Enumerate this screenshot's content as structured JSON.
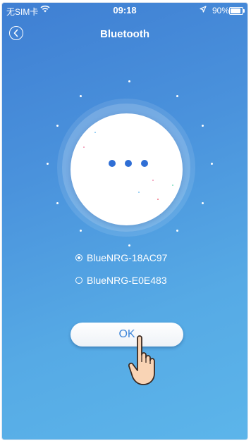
{
  "status_bar": {
    "carrier": "无SIM卡",
    "time": "09:18",
    "battery": "90%",
    "battery_level": 0.9
  },
  "header": {
    "title": "Bluetooth",
    "back_icon": "chevron-left-icon"
  },
  "devices": [
    {
      "name": "BlueNRG-18AC97",
      "selected": true
    },
    {
      "name": "BlueNRG-E0E483",
      "selected": false
    }
  ],
  "ok_button": {
    "label": "OK"
  },
  "icons": {
    "status": [
      "wifi-icon",
      "location-arrow-icon",
      "battery-icon"
    ],
    "scanning": "ellipsis-icon",
    "pointer": "pointing-hand-icon"
  },
  "colors": {
    "background_top": "#3f7fd3",
    "background_bottom": "#5cb5ea",
    "accent": "#2f6ed5",
    "text": "#ffffff"
  }
}
